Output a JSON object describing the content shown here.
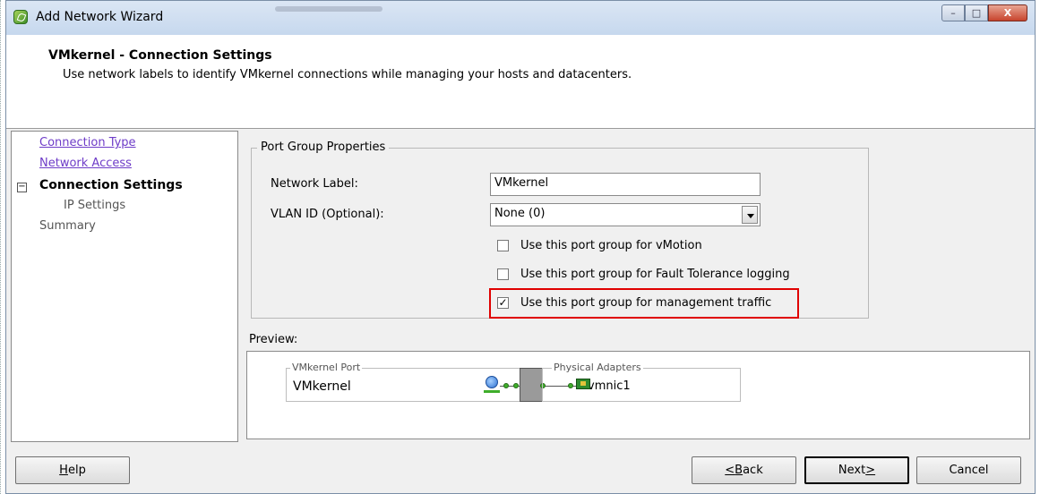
{
  "window": {
    "title": "Add Network Wizard",
    "minimize_glyph": "–",
    "maximize_glyph": "□",
    "close_glyph": "X"
  },
  "header": {
    "title": "VMkernel - Connection Settings",
    "subtitle": "Use network labels to identify VMkernel connections while managing your hosts and datacenters."
  },
  "nav": {
    "tree_toggle": "−",
    "items": [
      {
        "label": "Connection Type",
        "state": "link"
      },
      {
        "label": "Network Access",
        "state": "link"
      },
      {
        "label": "Connection Settings",
        "state": "current"
      },
      {
        "label": "IP Settings",
        "state": "pending"
      },
      {
        "label": "Summary",
        "state": "pending"
      }
    ]
  },
  "port_group": {
    "legend": "Port Group Properties",
    "network_label_caption": "Network Label:",
    "network_label_value": "VMkernel",
    "vlan_caption": "VLAN ID (Optional):",
    "vlan_value": "None (0)",
    "checkboxes": [
      {
        "label": "Use this port group for vMotion",
        "checked": false
      },
      {
        "label": "Use this port group for Fault Tolerance logging",
        "checked": false
      },
      {
        "label": "Use this port group for management traffic",
        "checked": true
      }
    ],
    "check_glyph": "✓"
  },
  "preview": {
    "label": "Preview:",
    "vmkernel_legend": "VMkernel Port",
    "vmkernel_name": "VMkernel",
    "adapters_legend": "Physical Adapters",
    "nic_name": "vmnic1"
  },
  "buttons": {
    "help": {
      "prefix": "",
      "mnemonic": "H",
      "rest": "elp"
    },
    "back": {
      "prefix": "< ",
      "mnemonic": "B",
      "rest": "ack"
    },
    "next": {
      "prefix": "Next ",
      "mnemonic": ">",
      "rest": ""
    },
    "cancel": "Cancel"
  },
  "colors": {
    "link": "#6e3cc8",
    "highlight": "#e00000",
    "link_dot": "#3fae2b"
  }
}
